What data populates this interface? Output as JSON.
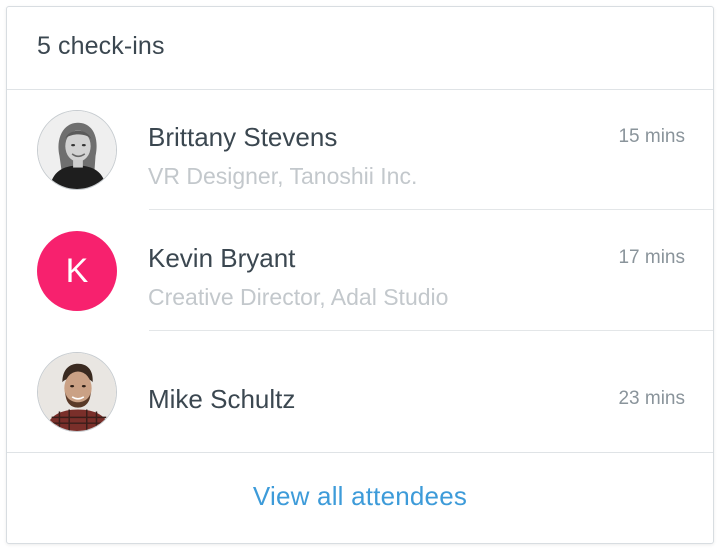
{
  "header": {
    "title": "5 check-ins"
  },
  "attendees": [
    {
      "name": "Brittany Stevens",
      "subtitle": "VR Designer, Tanoshii Inc.",
      "time": "15 mins",
      "avatar": "photo-woman-blonde"
    },
    {
      "name": "Kevin Bryant",
      "subtitle": "Creative Director, Adal Studio",
      "time": "17 mins",
      "avatar_letter": "K",
      "avatar_color": "#f7216e"
    },
    {
      "name": "Mike Schultz",
      "subtitle": "",
      "time": "23 mins",
      "avatar": "photo-man-beard"
    }
  ],
  "footer": {
    "link_label": "View all attendees"
  },
  "colors": {
    "text_primary": "#3b4750",
    "text_muted": "#c3c8cc",
    "time": "#8a949b",
    "link": "#3d9bd9",
    "avatar_pink": "#f7216e"
  }
}
